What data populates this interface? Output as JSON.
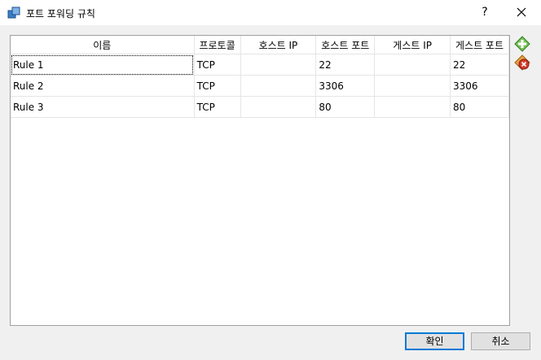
{
  "window": {
    "title": "포트 포워딩 규칙",
    "help_label": "?",
    "icons": {
      "app": "port-forward-icon",
      "close": "close-icon"
    }
  },
  "table": {
    "columns": [
      "이름",
      "프로토콜",
      "호스트 IP",
      "호스트 포트",
      "게스트 IP",
      "게스트 포트"
    ],
    "rows": [
      [
        "Rule 1",
        "TCP",
        "",
        "22",
        "",
        "22"
      ],
      [
        "Rule 2",
        "TCP",
        "",
        "3306",
        "",
        "3306"
      ],
      [
        "Rule 3",
        "TCP",
        "",
        "80",
        "",
        "80"
      ]
    ]
  },
  "side_buttons": {
    "add_icon": "add-rule-icon",
    "remove_icon": "remove-rule-icon"
  },
  "buttons": {
    "ok": "확인",
    "cancel": "취소"
  },
  "colors": {
    "focus_border": "#0078d7",
    "add_green": "#3aa12b",
    "remove_red": "#d23b2b"
  }
}
